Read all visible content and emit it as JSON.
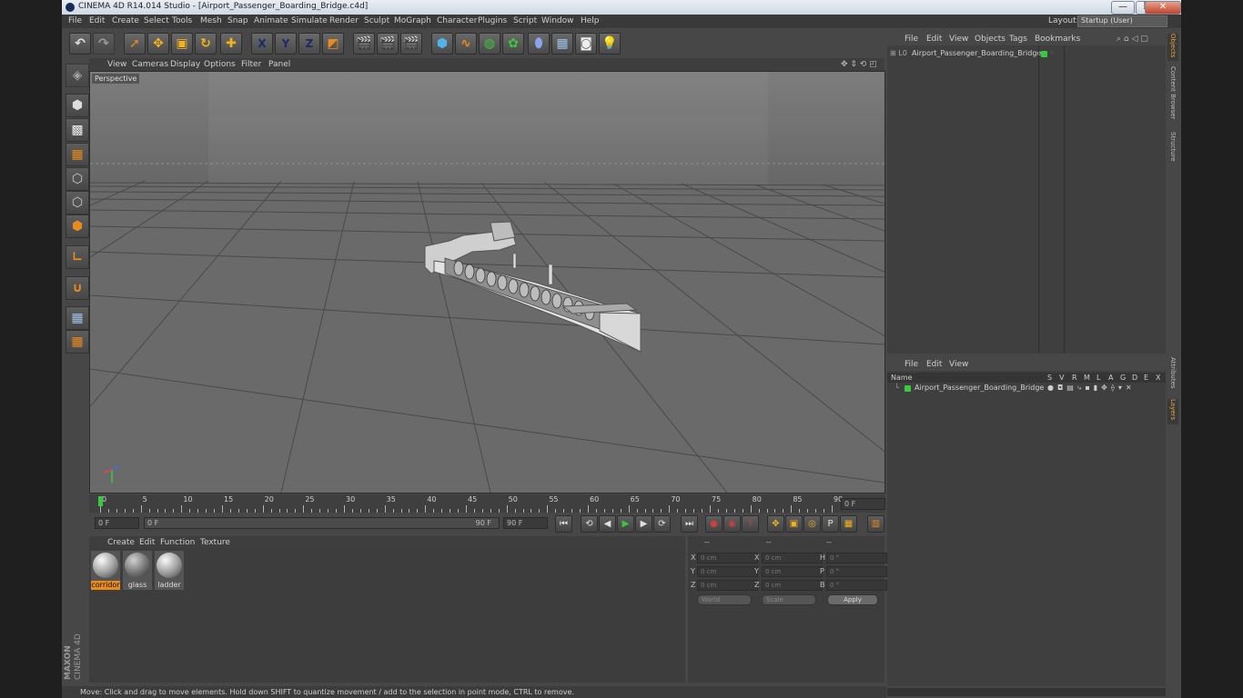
{
  "window": {
    "title": "CINEMA 4D R14.014 Studio - [Airport_Passenger_Boarding_Bridge.c4d]",
    "controls": [
      "—",
      "❐",
      "✕"
    ]
  },
  "menubar": {
    "items": [
      "File",
      "Edit",
      "Create",
      "Select",
      "Tools",
      "Mesh",
      "Snap",
      "Animate",
      "Simulate",
      "Render",
      "Sculpt",
      "MoGraph",
      "Character",
      "Plugins",
      "Script",
      "Window",
      "Help"
    ],
    "layout_label": "Layout:",
    "layout_value": "Startup (User)"
  },
  "toolbar": {
    "tools": [
      "undo-icon",
      "redo-icon",
      "select-icon",
      "move-icon",
      "scale-icon",
      "rotate-icon",
      "add-icon",
      "x-axis-icon",
      "y-axis-icon",
      "z-axis-icon",
      "coordinate-system-icon",
      "render-view-icon",
      "render-picture-viewer-icon",
      "render-settings-icon",
      "cube-icon",
      "spline-icon",
      "nurbs-icon",
      "array-icon",
      "deformer-icon",
      "floor-icon",
      "camera-icon",
      "light-icon"
    ],
    "axis_labels": [
      "X",
      "Y",
      "Z"
    ]
  },
  "viewport": {
    "menu": [
      "View",
      "Cameras",
      "Display",
      "Options",
      "Filter",
      "Panel"
    ],
    "label": "Perspective"
  },
  "timeline": {
    "ticks": [
      "0",
      "5",
      "10",
      "15",
      "20",
      "25",
      "30",
      "35",
      "40",
      "45",
      "50",
      "55",
      "60",
      "65",
      "70",
      "75",
      "80",
      "85",
      "90"
    ],
    "current_frame": "0 F"
  },
  "playback": {
    "start": "0 F",
    "slider_start": "0 F",
    "slider_end": "90 F",
    "end": "90 F"
  },
  "materials": {
    "menu": [
      "Create",
      "Edit",
      "Function",
      "Texture"
    ],
    "items": [
      {
        "name": "corridor",
        "selected": true
      },
      {
        "name": "glass",
        "selected": false
      },
      {
        "name": "ladder",
        "selected": false
      }
    ]
  },
  "coordinates": {
    "headers": [
      "--",
      "--",
      "--"
    ],
    "rows": [
      {
        "a": "X",
        "av": "0 cm",
        "b": "X",
        "bv": "0 cm",
        "c": "H",
        "cv": "0 °"
      },
      {
        "a": "Y",
        "av": "0 cm",
        "b": "Y",
        "bv": "0 cm",
        "c": "P",
        "cv": "0 °"
      },
      {
        "a": "Z",
        "av": "0 cm",
        "b": "Z",
        "bv": "0 cm",
        "c": "B",
        "cv": "0 °"
      }
    ],
    "world": "World",
    "scale": "Scale",
    "apply": "Apply"
  },
  "objects": {
    "menu": [
      "File",
      "Edit",
      "View",
      "Objects",
      "Tags",
      "Bookmarks"
    ],
    "items": [
      {
        "name": "Airport_Passenger_Boarding_Bridge"
      }
    ]
  },
  "layers": {
    "menu": [
      "File",
      "Edit",
      "View"
    ],
    "columns": [
      "Name",
      "S",
      "V",
      "R",
      "M",
      "L",
      "A",
      "G",
      "D",
      "E",
      "X"
    ],
    "items": [
      {
        "name": "Airport_Passenger_Boarding_Bridge"
      }
    ]
  },
  "right_tabs": [
    "Objects",
    "Content Browser",
    "Structure",
    "Attributes",
    "Layers"
  ],
  "status": "Move: Click and drag to move elements. Hold down SHIFT to quantize movement / add to the selection in point mode, CTRL to remove.",
  "brand": {
    "maxon": "MAXON",
    "product": "CINEMA 4D"
  },
  "colors": {
    "accent": "#e98b1d",
    "layer_green": "#3cc83c",
    "viewport_bg": "#6b6b6b"
  }
}
